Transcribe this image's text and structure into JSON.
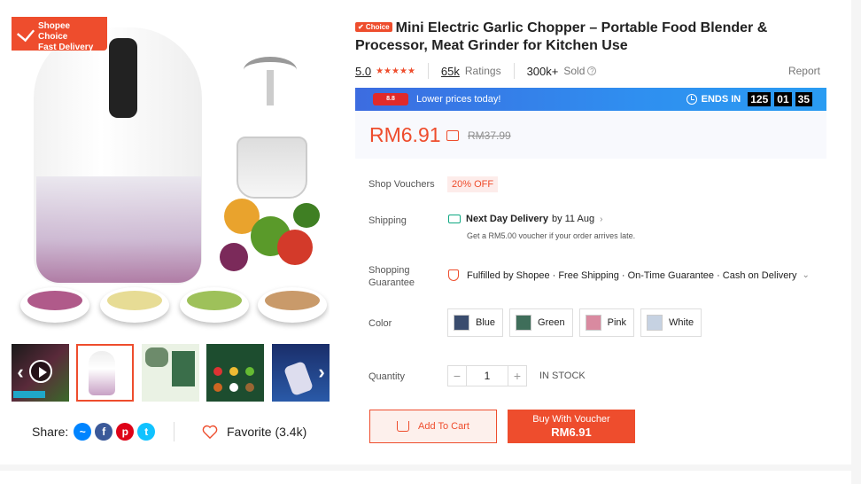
{
  "gallery": {
    "badge_line1": "Shopee Choice",
    "badge_line2": "Fast Delivery",
    "thumb_count": 6,
    "prev_arrow": "‹",
    "next_arrow": "›",
    "share_label": "Share:",
    "share_icons": [
      "messenger-icon",
      "facebook-icon",
      "pinterest-icon",
      "twitter-icon"
    ],
    "favorite_label": "Favorite (3.4k)"
  },
  "product": {
    "choice_tag": "✔ Choice",
    "title": "Mini Electric Garlic Chopper – Portable Food Blender & Processor, Meat Grinder for Kitchen Use",
    "rating": "5.0",
    "stars": 5,
    "ratings_count": "65k",
    "ratings_label": "Ratings",
    "sold_count": "300k+",
    "sold_label": "Sold",
    "report_label": "Report"
  },
  "flash_sale": {
    "logo": "8.8",
    "text": "Lower prices today!",
    "ends_label": "ENDS IN",
    "hours": "125",
    "minutes": "01",
    "seconds": "35"
  },
  "price": {
    "current": "RM6.91",
    "original": "RM37.99"
  },
  "details": {
    "voucher_label": "Shop Vouchers",
    "voucher_value": "20% OFF",
    "shipping_label": "Shipping",
    "shipping_main": "Next Day Delivery",
    "shipping_by": "by 11 Aug",
    "shipping_sub": "Get a RM5.00 voucher if your order arrives late.",
    "guarantee_label_1": "Shopping",
    "guarantee_label_2": "Guarantee",
    "guarantee_text": "Fulfilled by Shopee · Free Shipping · On-Time Guarantee · Cash on Delivery",
    "color_label": "Color",
    "colors": [
      {
        "name": "Blue",
        "swatch": "#3a4c6e"
      },
      {
        "name": "Green",
        "swatch": "#3f6e5a"
      },
      {
        "name": "Pink",
        "swatch": "#d98aa0"
      },
      {
        "name": "White",
        "swatch": "#c6d2e2"
      }
    ],
    "quantity_label": "Quantity",
    "quantity_value": "1",
    "minus": "−",
    "plus": "+",
    "stock": "IN STOCK"
  },
  "actions": {
    "add_to_cart": "Add To Cart",
    "buy_line1": "Buy With Voucher",
    "buy_line2": "RM6.91"
  },
  "colors": {
    "accent": "#ee4d2d",
    "flash_blue": "#2f8ff0",
    "delivery_green": "#0ea882"
  }
}
